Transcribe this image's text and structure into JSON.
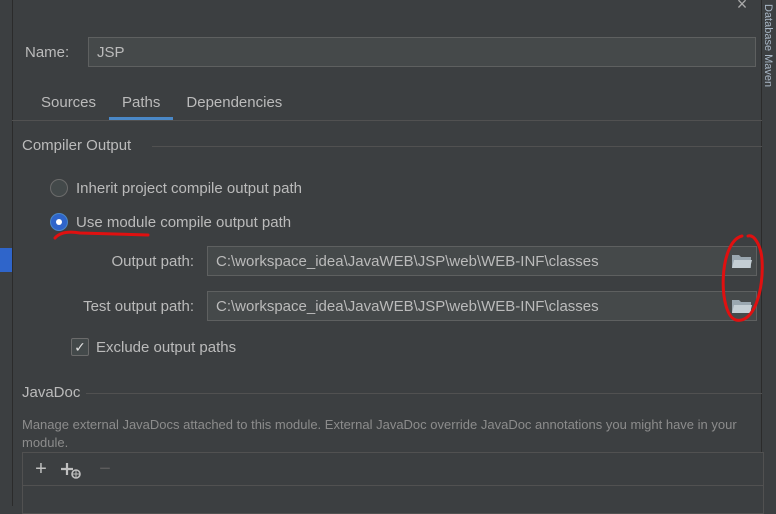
{
  "window": {
    "close_label": "×"
  },
  "name": {
    "label": "Name:",
    "value": "JSP"
  },
  "tabs": [
    {
      "label": "Sources",
      "active": false
    },
    {
      "label": "Paths",
      "active": true
    },
    {
      "label": "Dependencies",
      "active": false
    }
  ],
  "compiler_output": {
    "title": "Compiler Output",
    "inherit_label": "Inherit project compile output path",
    "use_module_label": "Use module compile output path",
    "selected": "use_module",
    "output_path_label": "Output path:",
    "output_path_value": "C:\\workspace_idea\\JavaWEB\\JSP\\web\\WEB-INF\\classes",
    "test_output_path_label": "Test output path:",
    "test_output_path_value": "C:\\workspace_idea\\JavaWEB\\JSP\\web\\WEB-INF\\classes",
    "exclude_label": "Exclude output paths",
    "exclude_checked": true
  },
  "javadoc": {
    "title": "JavaDoc",
    "description": "Manage external JavaDocs attached to this module. External JavaDoc override JavaDoc annotations you might have in your module."
  },
  "side_panel": {
    "right_label": "Database  Maven"
  },
  "icons": {
    "close": "close-icon",
    "folder": "folder-icon",
    "add": "plus-icon",
    "add_url": "add-url-icon",
    "remove": "minus-icon"
  },
  "colors": {
    "accent": "#4a88c7",
    "annotation": "#e01010",
    "background": "#3c3f41"
  }
}
